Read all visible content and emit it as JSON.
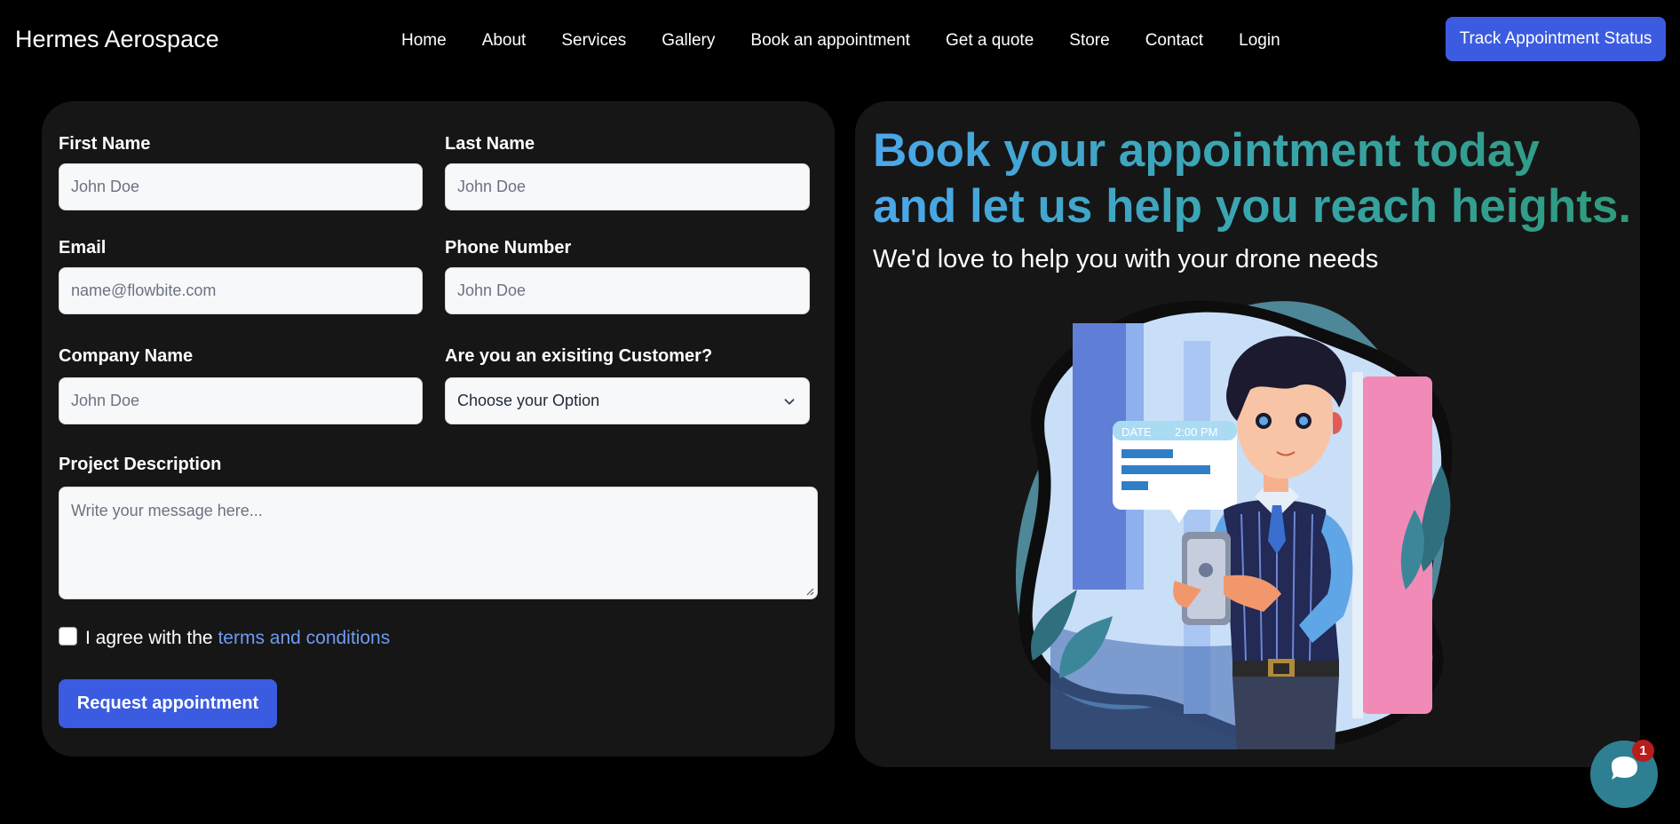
{
  "brand": "Hermes Aerospace",
  "nav": {
    "links": [
      "Home",
      "About",
      "Services",
      "Gallery",
      "Book an appointment",
      "Get a quote",
      "Store",
      "Contact",
      "Login"
    ],
    "track_button": "Track Appointment Status"
  },
  "form": {
    "first_name": {
      "label": "First Name",
      "placeholder": "John Doe"
    },
    "last_name": {
      "label": "Last Name",
      "placeholder": "John Doe"
    },
    "email": {
      "label": "Email",
      "placeholder": "name@flowbite.com"
    },
    "phone": {
      "label": "Phone Number",
      "placeholder": "John Doe"
    },
    "company": {
      "label": "Company Name",
      "placeholder": "John Doe"
    },
    "customer": {
      "label": "Are you an exisiting Customer?",
      "selected": "Choose your Option"
    },
    "description": {
      "label": "Project Description",
      "placeholder": "Write your message here..."
    },
    "agree_prefix": "I agree with the",
    "agree_link": "terms and conditions",
    "submit": "Request appointment"
  },
  "hero": {
    "headline_line1": "Book your appointment today",
    "headline_line2": "and let us help you reach heights.",
    "subheading": "We'd love to help you with your drone needs",
    "illustration": {
      "bubble_date": "DATE",
      "bubble_time": "2:00 PM"
    }
  },
  "chat": {
    "badge": "1"
  },
  "colors": {
    "accent": "#3b5be0",
    "card": "#161616",
    "link": "#6f9bf2",
    "headline_start": "#4ba7ec",
    "headline_end": "#2e9a7a"
  }
}
